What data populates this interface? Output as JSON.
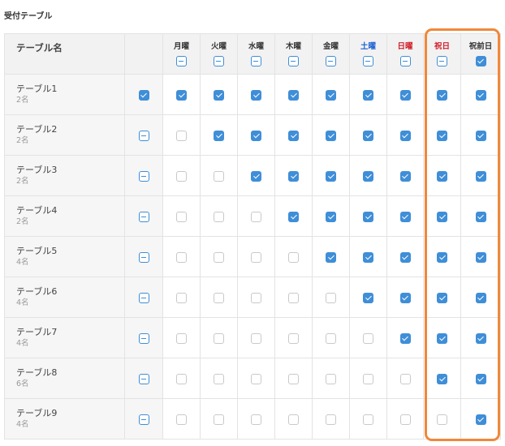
{
  "section_title": "受付テーブル",
  "header": {
    "name_label": "テーブル名",
    "all_label": "",
    "days": [
      {
        "label": "月曜",
        "style": "weekday",
        "state": "mixed"
      },
      {
        "label": "火曜",
        "style": "weekday",
        "state": "mixed"
      },
      {
        "label": "水曜",
        "style": "weekday",
        "state": "mixed"
      },
      {
        "label": "木曜",
        "style": "weekday",
        "state": "mixed"
      },
      {
        "label": "金曜",
        "style": "weekday",
        "state": "mixed"
      },
      {
        "label": "土曜",
        "style": "sat",
        "state": "mixed"
      },
      {
        "label": "日曜",
        "style": "sun",
        "state": "mixed"
      },
      {
        "label": "祝日",
        "style": "hol",
        "state": "mixed"
      },
      {
        "label": "祝前日",
        "style": "weekday",
        "state": "on"
      }
    ]
  },
  "rows": [
    {
      "name": "テーブル1",
      "capacity": "2名",
      "all": "on",
      "days": [
        1,
        1,
        1,
        1,
        1,
        1,
        1,
        1,
        1
      ]
    },
    {
      "name": "テーブル2",
      "capacity": "2名",
      "all": "mixed",
      "days": [
        0,
        1,
        1,
        1,
        1,
        1,
        1,
        1,
        1
      ]
    },
    {
      "name": "テーブル3",
      "capacity": "2名",
      "all": "mixed",
      "days": [
        0,
        0,
        1,
        1,
        1,
        1,
        1,
        1,
        1
      ]
    },
    {
      "name": "テーブル4",
      "capacity": "2名",
      "all": "mixed",
      "days": [
        0,
        0,
        0,
        1,
        1,
        1,
        1,
        1,
        1
      ]
    },
    {
      "name": "テーブル5",
      "capacity": "4名",
      "all": "mixed",
      "days": [
        0,
        0,
        0,
        0,
        1,
        1,
        1,
        1,
        1
      ]
    },
    {
      "name": "テーブル6",
      "capacity": "4名",
      "all": "mixed",
      "days": [
        0,
        0,
        0,
        0,
        0,
        1,
        1,
        1,
        1
      ]
    },
    {
      "name": "テーブル7",
      "capacity": "4名",
      "all": "mixed",
      "days": [
        0,
        0,
        0,
        0,
        0,
        0,
        1,
        1,
        1
      ]
    },
    {
      "name": "テーブル8",
      "capacity": "6名",
      "all": "mixed",
      "days": [
        0,
        0,
        0,
        0,
        0,
        0,
        0,
        1,
        1
      ]
    },
    {
      "name": "テーブル9",
      "capacity": "4名",
      "all": "mixed",
      "days": [
        0,
        0,
        0,
        0,
        0,
        0,
        0,
        0,
        1
      ]
    }
  ],
  "colors": {
    "checkbox_checked": "#3f8ed8",
    "saturday": "#1a5fd1",
    "sunday_holiday": "#d0202a",
    "highlight": "#f0883a"
  }
}
